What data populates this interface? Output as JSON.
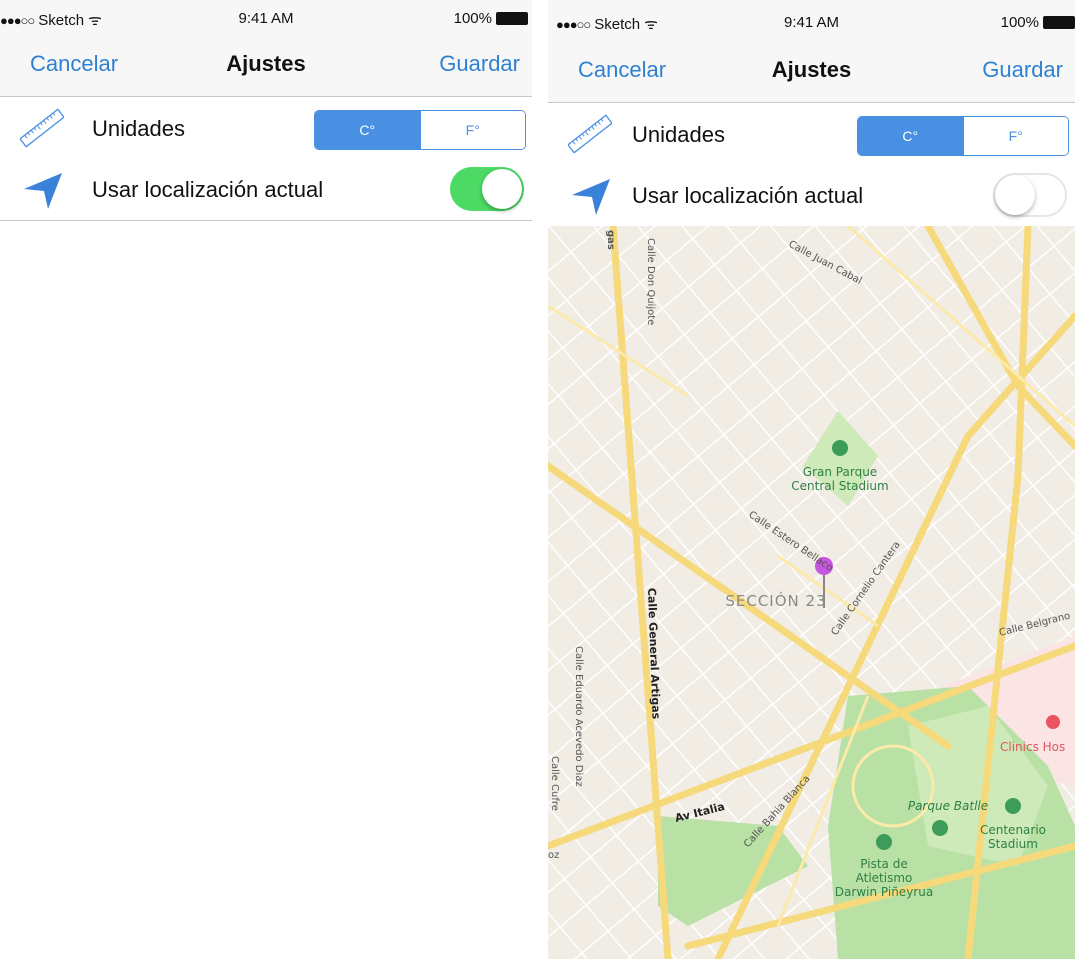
{
  "status_bar": {
    "carrier": "Sketch",
    "time": "9:41 AM",
    "battery": "100%"
  },
  "nav": {
    "cancel_label": "Cancelar",
    "title": "Ajustes",
    "save_label": "Guardar"
  },
  "settings": {
    "units_label": "Unidades",
    "units_options": [
      "C°",
      "F°"
    ],
    "units_selected": "C°",
    "location_label": "Usar localización actual"
  },
  "screens": [
    {
      "location_enabled": true
    },
    {
      "location_enabled": false
    }
  ],
  "map": {
    "streets": [
      "Calle Juan Cabal",
      "Calle Don Quijote",
      "gas",
      "Calle General Artigas",
      "Calle Estero Bellaco",
      "Calle Cornelio Cantera",
      "Calle Belgrano",
      "Calle Eduardo Acevedo Diaz",
      "Calle Cufre",
      "Av Italia",
      "Calle Bahia Blanca",
      "oz"
    ],
    "places": {
      "gran_parque_line1": "Gran Parque",
      "gran_parque_line2": "Central Stadium",
      "seccion": "SECCIÓN 23",
      "clinics": "Clinics Hos",
      "parque_batlle": "Parque Batlle",
      "centenario_line1": "Centenario",
      "centenario_line2": "Stadium",
      "pista_line1": "Pista de",
      "pista_line2": "Atletismo",
      "pista_line3": "Darwin Piñeyrua"
    }
  },
  "colors": {
    "accent": "#4a90e2",
    "nav_text": "#2f80d1",
    "toggle_on": "#4cd964",
    "pin": "#c857e0"
  }
}
